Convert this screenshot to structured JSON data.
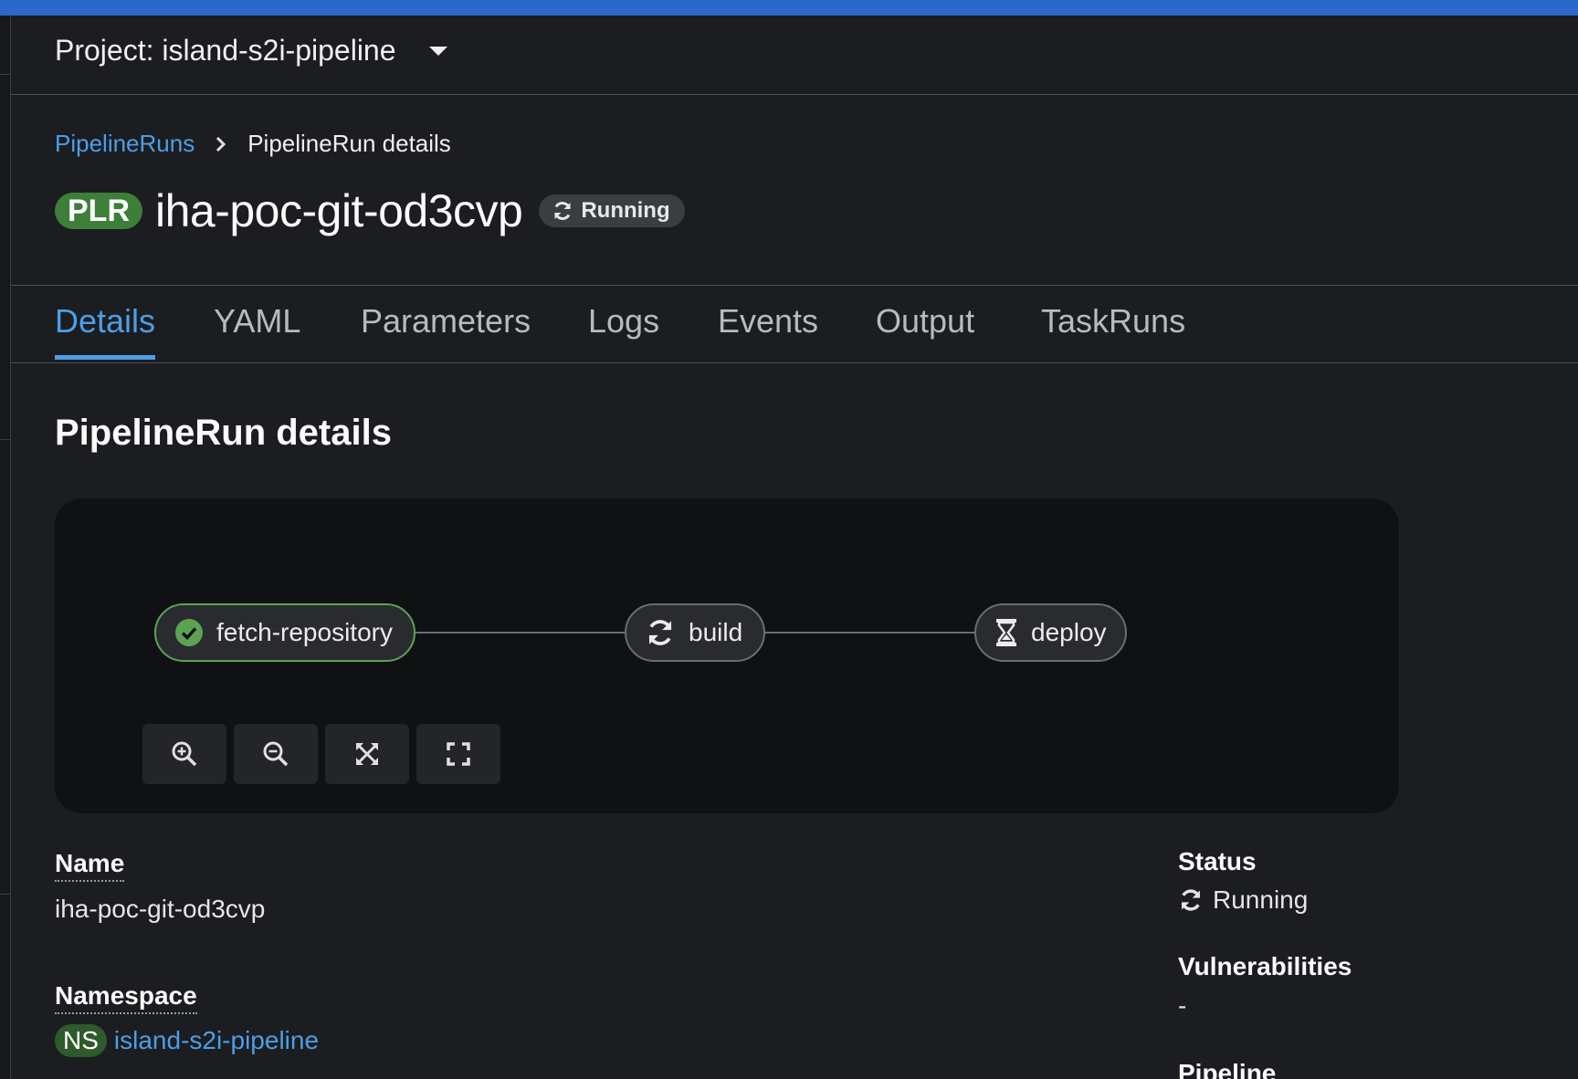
{
  "project": {
    "label": "Project: island-s2i-pipeline"
  },
  "breadcrumb": {
    "parent": "PipelineRuns",
    "current": "PipelineRun details"
  },
  "header": {
    "badge": "PLR",
    "title": "iha-poc-git-od3cvp",
    "status": "Running"
  },
  "tabs": [
    {
      "label": "Details",
      "active": true
    },
    {
      "label": "YAML"
    },
    {
      "label": "Parameters"
    },
    {
      "label": "Logs"
    },
    {
      "label": "Events"
    },
    {
      "label": "Output"
    },
    {
      "label": "TaskRuns"
    }
  ],
  "section": {
    "title": "PipelineRun details"
  },
  "graph": {
    "nodes": [
      {
        "label": "fetch-repository",
        "status": "succeeded",
        "icon": "check-circle-icon"
      },
      {
        "label": "build",
        "status": "running",
        "icon": "sync-icon"
      },
      {
        "label": "deploy",
        "status": "pending",
        "icon": "hourglass-icon"
      }
    ],
    "controls": [
      {
        "name": "zoom-in",
        "icon": "zoom-in-icon"
      },
      {
        "name": "zoom-out",
        "icon": "zoom-out-icon"
      },
      {
        "name": "fit-to-screen",
        "icon": "expand-arrows-icon"
      },
      {
        "name": "reset-view",
        "icon": "fullscreen-icon"
      }
    ]
  },
  "details": {
    "name_label": "Name",
    "name_value": "iha-poc-git-od3cvp",
    "namespace_label": "Namespace",
    "namespace_badge": "NS",
    "namespace_value": "island-s2i-pipeline",
    "status_label": "Status",
    "status_value": "Running",
    "vulnerabilities_label": "Vulnerabilities",
    "vulnerabilities_value": "-",
    "pipeline_label": "Pipeline"
  },
  "colors": {
    "accent": "#4d9ee6",
    "success": "#5ba352",
    "plr_badge": "#3d7e38",
    "topbar": "#2b68c9"
  }
}
